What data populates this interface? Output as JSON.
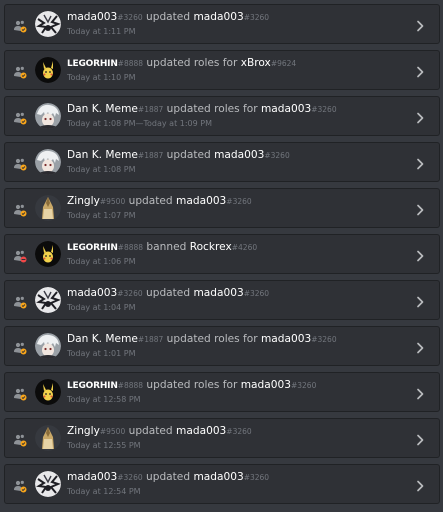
{
  "audit_log": {
    "entries": [
      {
        "actor": "mada003",
        "actor_disc": "#3260",
        "verb": "updated",
        "target": "mada003",
        "target_disc": "#3260",
        "time": "Today at 1:11 PM",
        "avatar": "manga-avatar",
        "action": "member-update"
      },
      {
        "actor": "LEGORHIN",
        "actor_disc": "#8888",
        "verb": "updated roles for",
        "target": "xBrox",
        "target_disc": "#9624",
        "time": "Today at 1:10 PM",
        "avatar": "pikachu-avatar",
        "action": "role-update"
      },
      {
        "actor": "Dan K. Meme",
        "actor_disc": "#1887",
        "verb": "updated roles for",
        "target": "mada003",
        "target_disc": "#3260",
        "time": "Today at 1:08 PM—Today at 1:09 PM",
        "avatar": "anime-avatar",
        "action": "role-update"
      },
      {
        "actor": "Dan K. Meme",
        "actor_disc": "#1887",
        "verb": "updated",
        "target": "mada003",
        "target_disc": "#3260",
        "time": "Today at 1:08 PM",
        "avatar": "anime-avatar",
        "action": "member-update"
      },
      {
        "actor": "Zingly",
        "actor_disc": "#9500",
        "verb": "updated",
        "target": "mada003",
        "target_disc": "#3260",
        "time": "Today at 1:07 PM",
        "avatar": "hooded-avatar",
        "action": "member-update"
      },
      {
        "actor": "LEGORHIN",
        "actor_disc": "#8888",
        "verb": "banned",
        "target": "Rockrex",
        "target_disc": "#4260",
        "time": "Today at 1:06 PM",
        "avatar": "pikachu-avatar",
        "action": "ban"
      },
      {
        "actor": "mada003",
        "actor_disc": "#3260",
        "verb": "updated",
        "target": "mada003",
        "target_disc": "#3260",
        "time": "Today at 1:04 PM",
        "avatar": "manga-avatar",
        "action": "member-update"
      },
      {
        "actor": "Dan K. Meme",
        "actor_disc": "#1887",
        "verb": "updated roles for",
        "target": "mada003",
        "target_disc": "#3260",
        "time": "Today at 1:01 PM",
        "avatar": "anime-avatar",
        "action": "role-update"
      },
      {
        "actor": "LEGORHIN",
        "actor_disc": "#8888",
        "verb": "updated roles for",
        "target": "mada003",
        "target_disc": "#3260",
        "time": "Today at 12:58 PM",
        "avatar": "pikachu-avatar",
        "action": "role-update"
      },
      {
        "actor": "Zingly",
        "actor_disc": "#9500",
        "verb": "updated",
        "target": "mada003",
        "target_disc": "#3260",
        "time": "Today at 12:55 PM",
        "avatar": "hooded-avatar",
        "action": "member-update"
      },
      {
        "actor": "mada003",
        "actor_disc": "#3260",
        "verb": "updated",
        "target": "mada003",
        "target_disc": "#3260",
        "time": "Today at 12:54 PM",
        "avatar": "manga-avatar",
        "action": "member-update"
      }
    ]
  },
  "colors": {
    "background": "#36393f",
    "entry_background": "#2f3136",
    "update_badge": "#faa61a",
    "ban_badge": "#f04747",
    "username": "#ffffff",
    "muted": "#72767d"
  }
}
